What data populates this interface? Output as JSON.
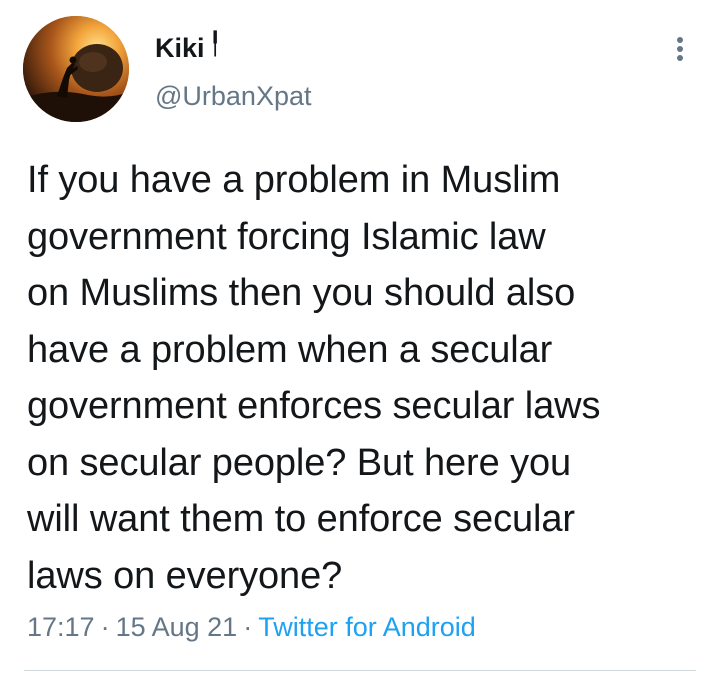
{
  "tweet": {
    "author": {
      "display_name": "Kiki",
      "name_glyph": "╿",
      "handle": "@UrbanXpat"
    },
    "menu_icon": "more-vertical-icon",
    "text": "If you have a problem in Muslim\ngovernment forcing Islamic law\non Muslims then you should also\nhave a problem when a secular\ngovernment enforces secular laws\non secular people? But here you\nwill want them to enforce secular\nlaws on everyone?",
    "time": "17:17",
    "separator": "·",
    "date": "15 Aug 21",
    "source": "Twitter for Android"
  },
  "colors": {
    "text": "#14171a",
    "secondary": "#657786",
    "accent": "#1da1f2",
    "divider": "#cfd9de"
  }
}
